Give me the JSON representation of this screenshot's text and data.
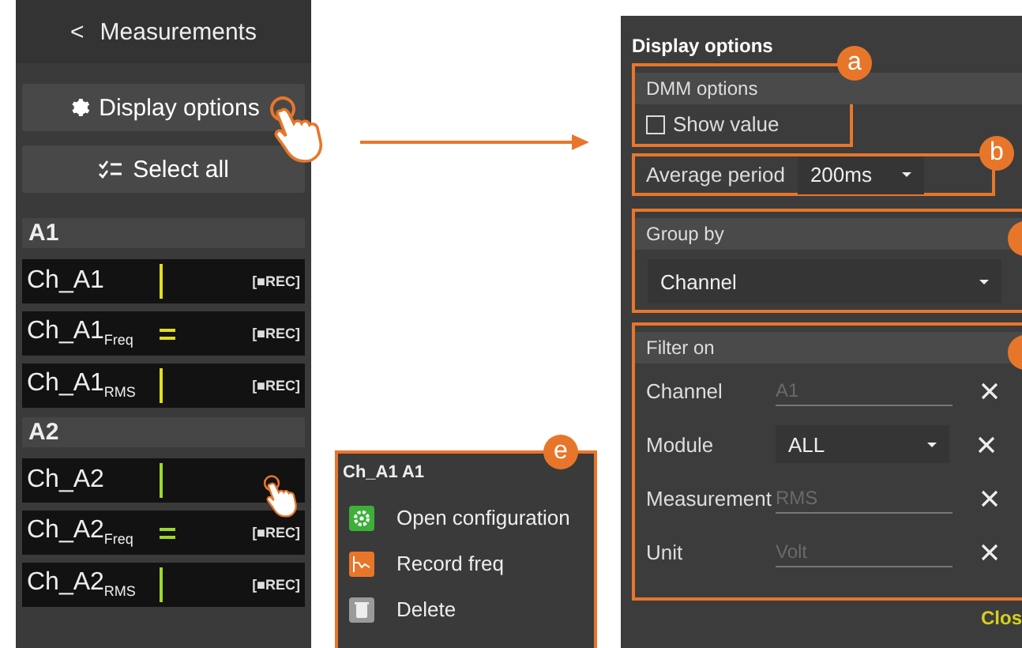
{
  "left_panel": {
    "back_icon": "<",
    "title": "Measurements",
    "buttons": [
      {
        "kind": "gear",
        "label": "Display options"
      },
      {
        "kind": "checklist",
        "label": "Select all"
      }
    ],
    "groups": [
      {
        "label": "A1",
        "rows": [
          {
            "name": "Ch_A1",
            "kind": "bar",
            "color": "#e2dc1c",
            "rec": "[■REC]"
          },
          {
            "name": "Ch_A1$_{Freq}$",
            "kind": "equals",
            "color": "#e2dc1c",
            "rec": "[■REC]"
          },
          {
            "name": "Ch_A1$_{RMS}$",
            "kind": "bar",
            "color": "#e2dc1c",
            "rec": "[■REC]"
          }
        ]
      },
      {
        "label": "A2",
        "rows": [
          {
            "name": "Ch_A2",
            "kind": "bar",
            "color": "#9ed82a"
          },
          {
            "name": "Ch_A2$_{Freq}$",
            "kind": "equals",
            "color": "#9ed82a",
            "rec": "[■REC]"
          },
          {
            "name": "Ch_A2$_{RMS}$",
            "kind": "bar",
            "color": "#9ed82a",
            "rec": "[■REC]"
          }
        ]
      }
    ]
  },
  "context_menu": {
    "title": "Ch_A1 A1",
    "badge": "e",
    "items": [
      {
        "kind": "config",
        "label": "Open configuration"
      },
      {
        "kind": "record",
        "label": "Record freq"
      },
      {
        "kind": "delete",
        "label": "Delete"
      }
    ]
  },
  "display_options": {
    "title": "Display options",
    "dmm": {
      "badge": "a",
      "header": "DMM options",
      "checkbox_label": "Show value",
      "checked": false
    },
    "average": {
      "badge": "b",
      "label": "Average period",
      "value": "200ms"
    },
    "group_by": {
      "header": "Group by",
      "value": "Channel"
    },
    "filter": {
      "header": "Filter on",
      "rows": [
        {
          "kind": "text",
          "label": "Channel",
          "placeholder": "A1"
        },
        {
          "kind": "select",
          "label": "Module",
          "value": "ALL"
        },
        {
          "kind": "text",
          "label": "Measurement",
          "placeholder": "RMS"
        },
        {
          "kind": "text",
          "label": "Unit",
          "placeholder": "Volt"
        }
      ]
    },
    "close": "Clos"
  }
}
